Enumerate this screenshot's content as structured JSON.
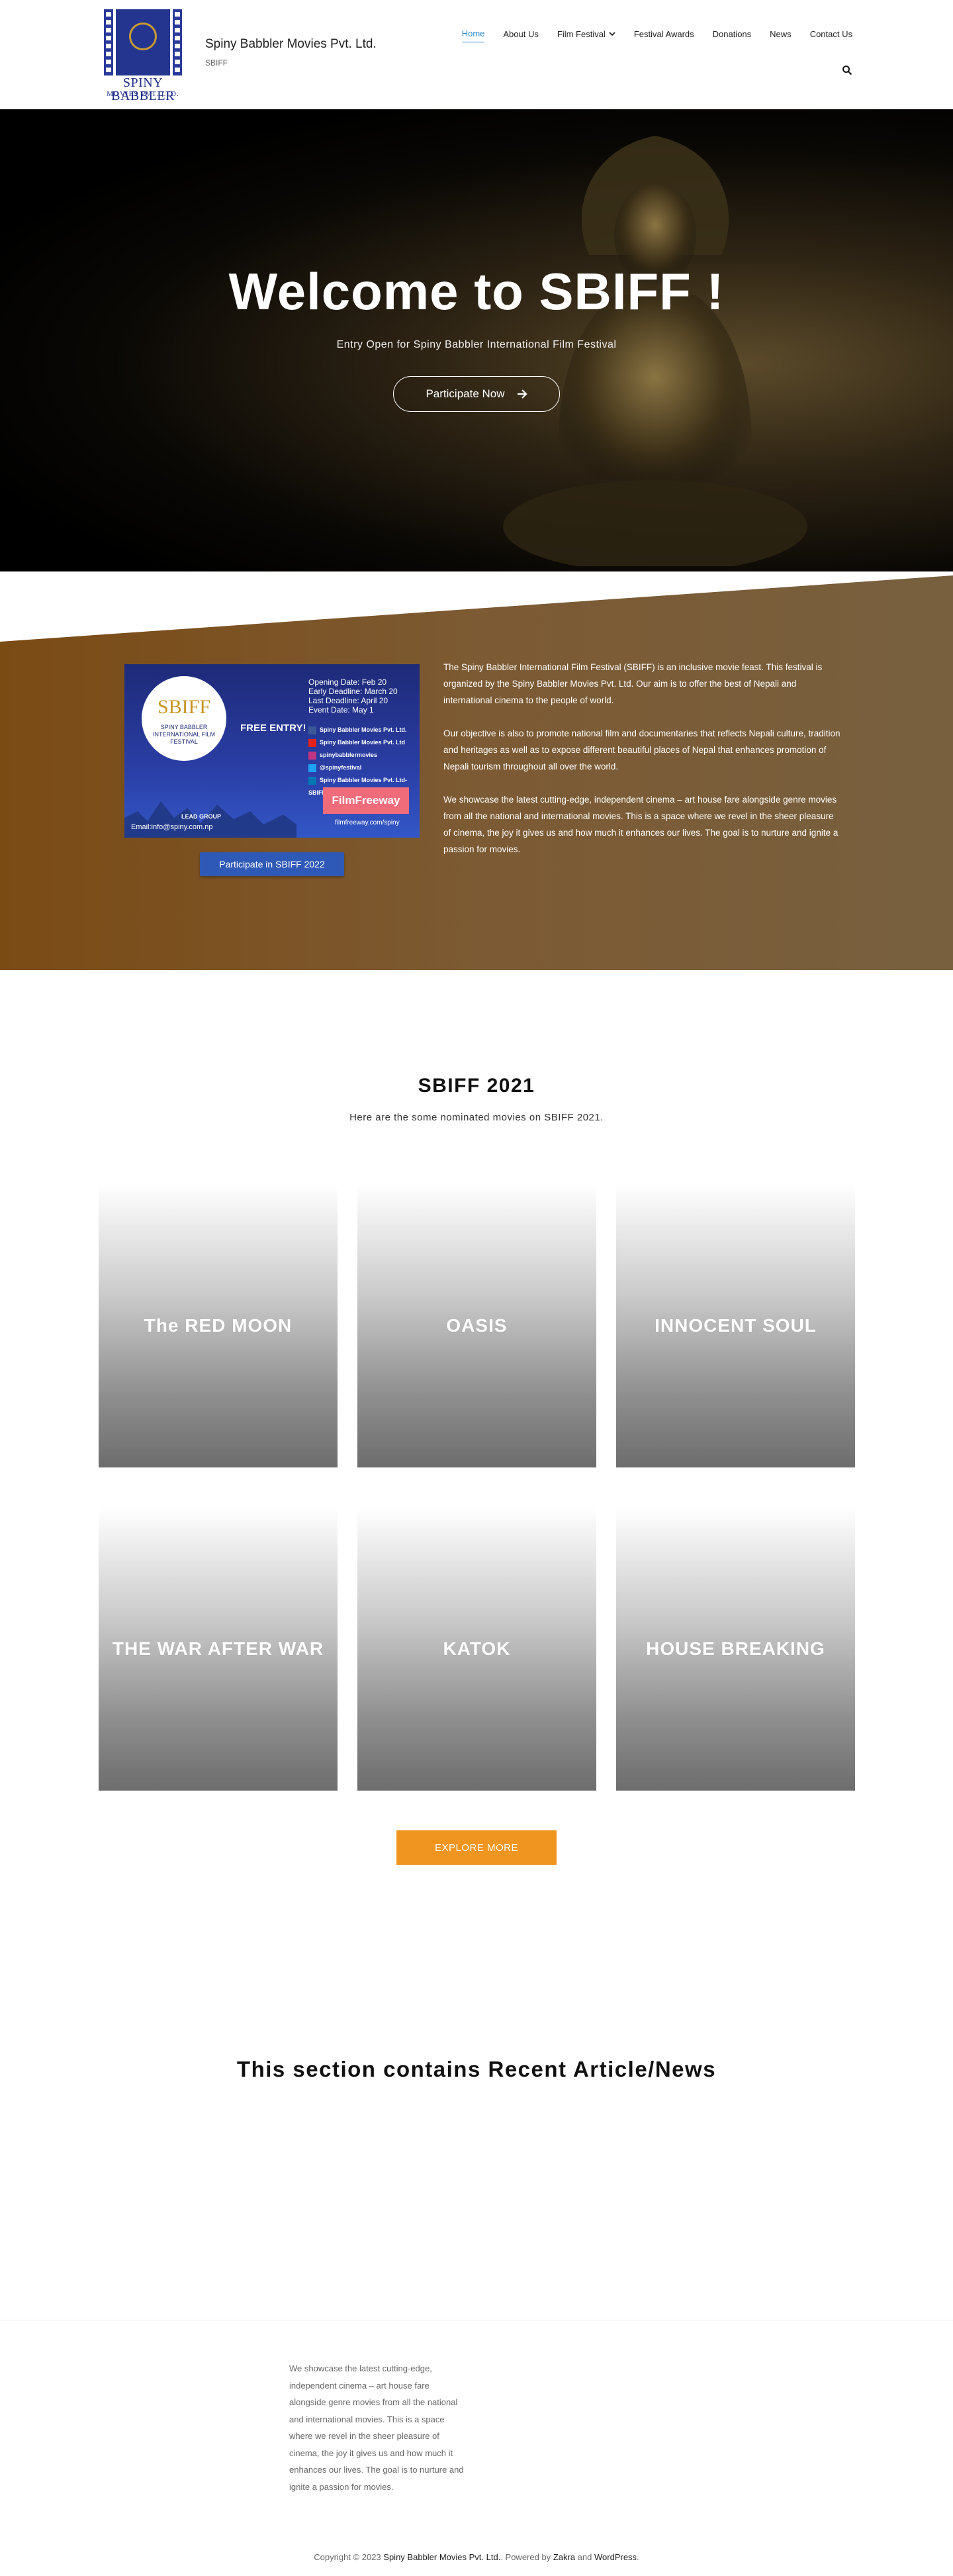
{
  "header": {
    "logo_text": "SPINY BABBLER",
    "logo_sub": "MOVIES PVT. LTD.",
    "site_title": "Spiny Babbler Movies Pvt. Ltd.",
    "tagline": "SBIFF",
    "nav": [
      {
        "label": "Home"
      },
      {
        "label": "About Us"
      },
      {
        "label": "Film Festival"
      },
      {
        "label": "Festival Awards"
      },
      {
        "label": "Donations"
      },
      {
        "label": "News"
      },
      {
        "label": "Contact Us"
      }
    ]
  },
  "hero": {
    "title": "Welcome to SBIFF !",
    "subtitle": "Entry Open for Spiny Babbler International Film Festival",
    "button": "Participate Now"
  },
  "about": {
    "poster": {
      "logo": "SBIFF",
      "circle_text": "SPINY BABBLER INTERNATIONAL FILM FESTIVAL",
      "free": "FREE ENTRY!",
      "dates": [
        "Opening Date: Feb 20",
        "Early Deadline: March 20",
        "Last Deadline: April 20",
        "Event Date: May 1"
      ],
      "social": [
        "Spiny Babbler Movies Pvt. Ltd.",
        "Spiny Babbler Movies Pvt. Ltd",
        "spinybabblermovies",
        "@spinyfestival",
        "Spiny Babbler Movies Pvt. Ltd-SBIFF"
      ],
      "filmfreeway": "FilmFreeway",
      "filmfreeway_url": "filmfreeway.com/spiny",
      "org": "LEAD GROUP",
      "email": "Email:info@spiny.com.np"
    },
    "button": "Participate in SBIFF 2022",
    "paragraphs": [
      "The Spiny Babbler International Film Festival (SBIFF) is an inclusive movie feast. This festival is organized by the Spiny Babbler Movies Pvt. Ltd. Our aim is to offer the best of Nepali and international cinema to the people of world.",
      "Our objective is also to promote national film and documentaries that reflects Nepali culture, tradition and heritages as well as to expose different beautiful places of Nepal that enhances promotion of Nepali tourism throughout all over the world.",
      "We showcase the latest cutting-edge, independent cinema – art house fare alongside genre movies from all the national and international movies. This is a space where we revel in the sheer pleasure of cinema, the joy it gives us and how much it enhances our lives. The goal is to nurture and ignite a passion for movies."
    ]
  },
  "movies": {
    "title": "SBIFF 2021",
    "subtitle": "Here are the some nominated movies on SBIFF 2021.",
    "items": [
      {
        "title": "The RED MOON"
      },
      {
        "title": "OASIS"
      },
      {
        "title": "INNOCENT SOUL"
      },
      {
        "title": "THE WAR AFTER WAR"
      },
      {
        "title": "KATOK"
      },
      {
        "title": "HOUSE BREAKING"
      }
    ],
    "explore": "EXPLORE MORE"
  },
  "news": {
    "title": "This section contains Recent Article/News"
  },
  "footer": {
    "text": "We showcase the latest cutting-edge, independent cinema – art house fare alongside genre movies from all the national and international movies. This is a space where we revel in the sheer pleasure of cinema, the joy it gives us and how much it enhances our lives. The goal is to nurture and ignite a passion for movies.",
    "copy_prefix": "Copyright © 2023",
    "company": "Spiny Babbler Movies Pvt. Ltd.",
    "powered_by": ". Powered by",
    "theme": "Zakra",
    "and": "and",
    "wp": "WordPress",
    "end": "."
  },
  "colors": {
    "accent": "#2b87d0",
    "about_bg": "#7b4b14",
    "explore_btn": "#f0951f",
    "about_btn": "#2f59b6"
  }
}
